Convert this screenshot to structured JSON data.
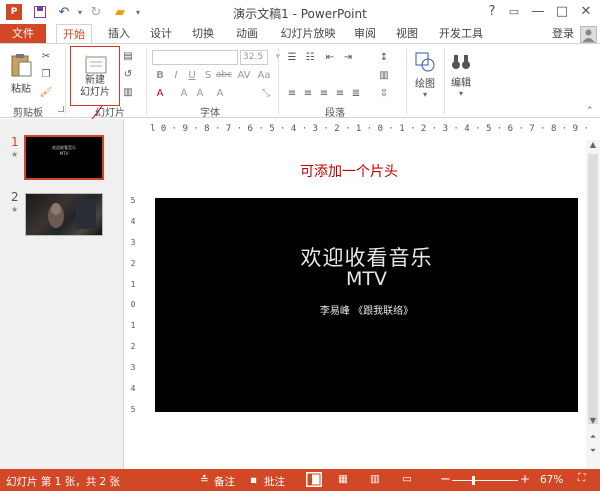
{
  "window": {
    "title": "演示文稿1 - PowerPoint",
    "controls": {
      "help": "?",
      "restore": "▭",
      "minimize": "—",
      "maximize": "□",
      "close": "✕"
    }
  },
  "qat": {
    "icons": [
      "powerpoint-logo-icon",
      "save-icon",
      "undo-icon",
      "redo-icon",
      "open-icon"
    ]
  },
  "tabs": [
    {
      "label": "文件",
      "active": false
    },
    {
      "label": "开始",
      "active": true
    },
    {
      "label": "插入"
    },
    {
      "label": "设计"
    },
    {
      "label": "切换"
    },
    {
      "label": "动画"
    },
    {
      "label": "幻灯片放映"
    },
    {
      "label": "审阅"
    },
    {
      "label": "视图"
    },
    {
      "label": "开发工具"
    }
  ],
  "account": {
    "signin": "登录"
  },
  "ribbon": {
    "clipboard": {
      "paste": "粘贴",
      "group": "剪贴板"
    },
    "slides": {
      "new_slide_line1": "新建",
      "new_slide_line2": "幻灯片",
      "group": "幻灯片"
    },
    "font": {
      "size": "32.5",
      "group": "字体"
    },
    "paragraph": {
      "group": "段落"
    },
    "drawing": {
      "label": "绘图"
    },
    "editing": {
      "label": "编辑"
    }
  },
  "annotation": {
    "text": "可添加一个片头",
    "color": "#c00000"
  },
  "thumbnails": [
    {
      "number": "1",
      "star": "★",
      "selected": true
    },
    {
      "number": "2",
      "star": "★",
      "selected": false
    }
  ],
  "slide": {
    "title_line1": "欢迎收看音乐",
    "title_line2": "MTV",
    "subtitle": "李易峰 《跟我联络》",
    "background": "#000000"
  },
  "ruler": {
    "h": "l 0 · 9 · 8 · 7 · 6 · 5 · 4 · 3 · 2 · 1 · 0 · 1 · 2 · 3 · 4 · 5 · 6 · 7 · 8 · 9 · 10 ·",
    "v": [
      "5",
      "4",
      "3",
      "2",
      "1",
      "0",
      "1",
      "2",
      "3",
      "4",
      "5"
    ]
  },
  "status": {
    "slide_info": "幻灯片 第 1 张，共 2 张",
    "notes": "备注",
    "comments": "批注",
    "zoom": "67%",
    "zoom_level": 0.67
  },
  "colors": {
    "accent": "#d24726",
    "status_bar": "#d24726"
  }
}
